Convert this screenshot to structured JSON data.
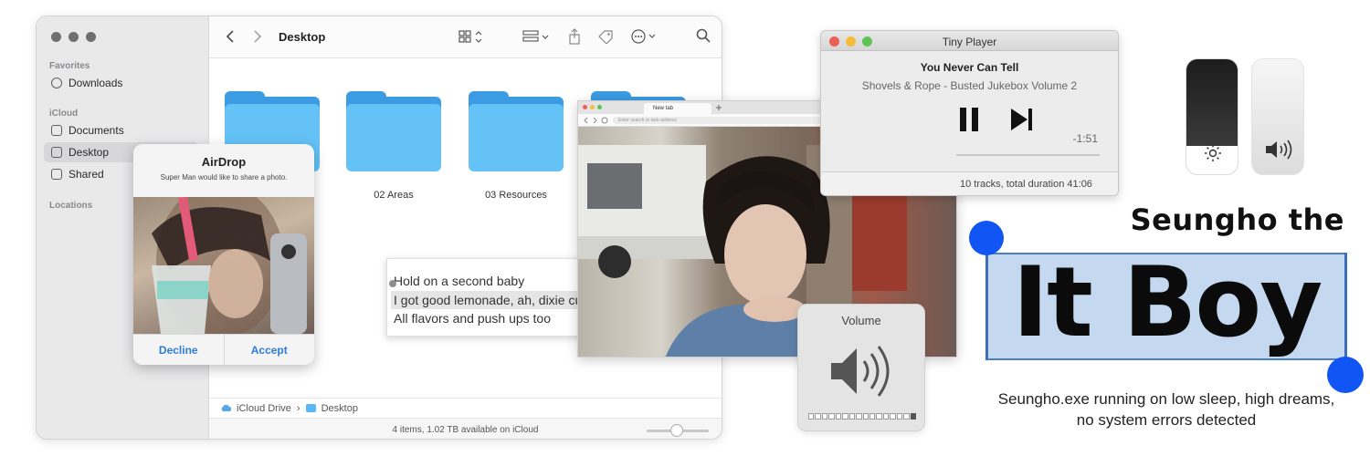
{
  "finder": {
    "title": "Desktop",
    "sidebar": {
      "favorites_label": "Favorites",
      "icloud_label": "iCloud",
      "locations_label": "Locations",
      "items": [
        {
          "label": "Downloads",
          "icon": "download-icon"
        },
        {
          "label": "Documents",
          "icon": "document-icon"
        },
        {
          "label": "Desktop",
          "icon": "desktop-icon",
          "selected": true
        },
        {
          "label": "Shared",
          "icon": "shared-folder-icon"
        }
      ]
    },
    "folders": [
      {
        "label": ""
      },
      {
        "label": "02 Areas"
      },
      {
        "label": "03 Resources"
      },
      {
        "label": ""
      }
    ],
    "path": {
      "root": "iCloud Drive",
      "separator": "›",
      "current": "Desktop"
    },
    "status": "4 items, 1.02 TB available on iCloud"
  },
  "airdrop": {
    "title": "AirDrop",
    "message": "Super Man would like to share a photo.",
    "decline_label": "Decline",
    "accept_label": "Accept"
  },
  "lyrics": {
    "lines": [
      "Hold on a second baby",
      "I got good lemonade, ah, dixie cups",
      "All flavors and push ups too"
    ]
  },
  "browser": {
    "tab_label": "New tab",
    "url_placeholder": "Enter search or web address"
  },
  "player": {
    "window_title": "Tiny Player",
    "song": "You Never Can Tell",
    "artist_album": "Shovels & Rope - Busted Jukebox Volume 2",
    "time_remaining": "-1:51",
    "footer": "10 tracks, total duration 41:06"
  },
  "volume_hud": {
    "title": "Volume",
    "level_segments_on": 1,
    "level_segments_total": 16
  },
  "branding": {
    "headline": "Seungho the",
    "big_text": "It Boy",
    "caption": "Seungho.exe running on low sleep, high dreams, no system errors detected"
  },
  "colors": {
    "accent_blue": "#1255f5",
    "banner_blue": "#c4d8f0",
    "folder_blue": "#64c2f7",
    "link_blue": "#2f7bd8"
  }
}
